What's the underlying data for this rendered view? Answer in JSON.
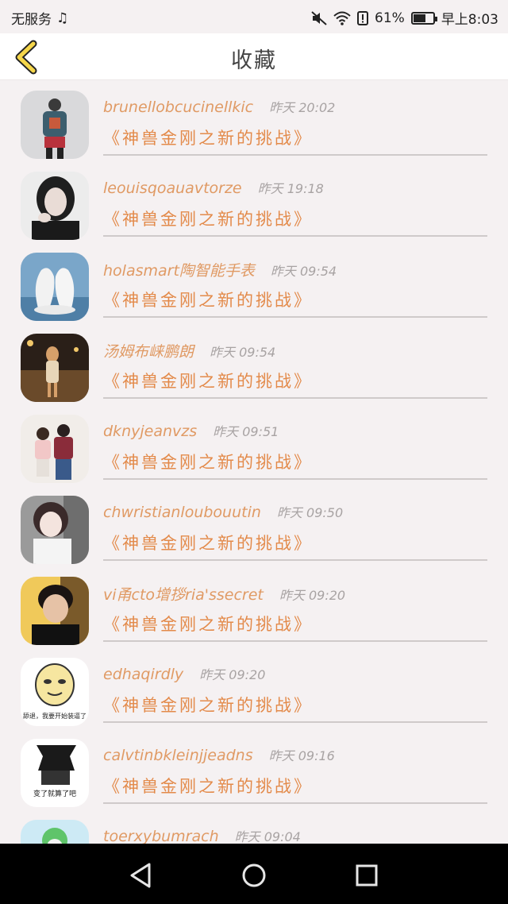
{
  "status": {
    "carrier": "无服务",
    "battery": "61%",
    "time": "早上8:03"
  },
  "header": {
    "title": "收藏"
  },
  "items": [
    {
      "name": "brunellobcucinellkic",
      "time": "昨天 20:02",
      "title": "《神兽金刚之新的挑战》"
    },
    {
      "name": "leouisqoauavtorze",
      "time": "昨天 19:18",
      "title": "《神兽金刚之新的挑战》"
    },
    {
      "name": "holasmart陶智能手表",
      "time": "昨天 09:54",
      "title": "《神兽金刚之新的挑战》"
    },
    {
      "name": "汤姆布崃鹏朗",
      "time": "昨天 09:54",
      "title": "《神兽金刚之新的挑战》"
    },
    {
      "name": "dknyjeanvzs",
      "time": "昨天 09:51",
      "title": "《神兽金刚之新的挑战》"
    },
    {
      "name": "chwristianloubouutin",
      "time": "昨天 09:50",
      "title": "《神兽金刚之新的挑战》"
    },
    {
      "name": "vi甬cto增拶ria'ssecret",
      "time": "昨天 09:20",
      "title": "《神兽金刚之新的挑战》"
    },
    {
      "name": "edhaqirdly",
      "time": "昨天 09:20",
      "title": "《神兽金刚之新的挑战》"
    },
    {
      "name": "calvtinbkleinjjeadns",
      "time": "昨天 09:16",
      "title": "《神兽金刚之新的挑战》"
    },
    {
      "name": "toerxybumrach",
      "time": "昨天 09:04",
      "title": ""
    }
  ],
  "avatar_texts": {
    "a8": "舔退，我要开始装逼了",
    "a9": "变了就算了吧"
  }
}
